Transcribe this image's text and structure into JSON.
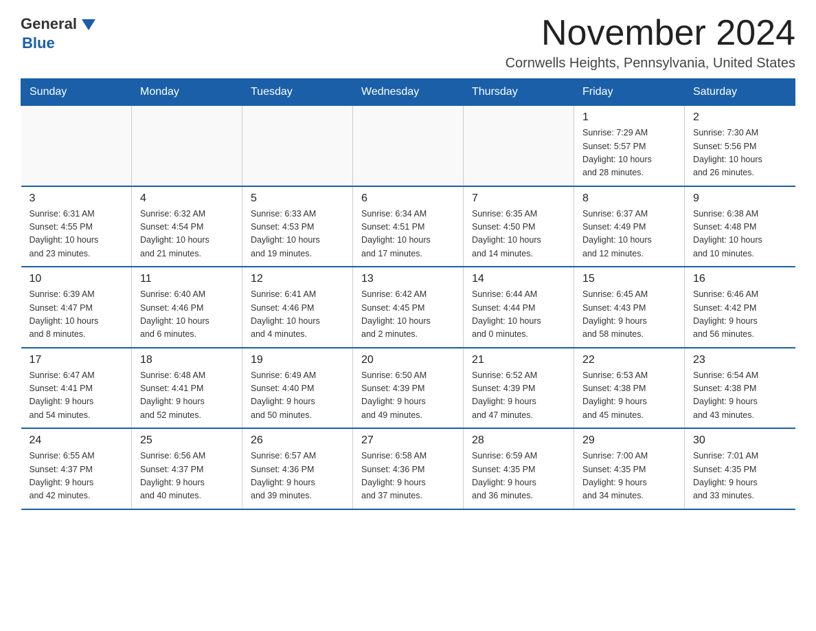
{
  "header": {
    "logo_general": "General",
    "logo_blue": "Blue",
    "month_title": "November 2024",
    "location": "Cornwells Heights, Pennsylvania, United States"
  },
  "days_of_week": [
    "Sunday",
    "Monday",
    "Tuesday",
    "Wednesday",
    "Thursday",
    "Friday",
    "Saturday"
  ],
  "weeks": [
    [
      {
        "day": "",
        "info": ""
      },
      {
        "day": "",
        "info": ""
      },
      {
        "day": "",
        "info": ""
      },
      {
        "day": "",
        "info": ""
      },
      {
        "day": "",
        "info": ""
      },
      {
        "day": "1",
        "info": "Sunrise: 7:29 AM\nSunset: 5:57 PM\nDaylight: 10 hours\nand 28 minutes."
      },
      {
        "day": "2",
        "info": "Sunrise: 7:30 AM\nSunset: 5:56 PM\nDaylight: 10 hours\nand 26 minutes."
      }
    ],
    [
      {
        "day": "3",
        "info": "Sunrise: 6:31 AM\nSunset: 4:55 PM\nDaylight: 10 hours\nand 23 minutes."
      },
      {
        "day": "4",
        "info": "Sunrise: 6:32 AM\nSunset: 4:54 PM\nDaylight: 10 hours\nand 21 minutes."
      },
      {
        "day": "5",
        "info": "Sunrise: 6:33 AM\nSunset: 4:53 PM\nDaylight: 10 hours\nand 19 minutes."
      },
      {
        "day": "6",
        "info": "Sunrise: 6:34 AM\nSunset: 4:51 PM\nDaylight: 10 hours\nand 17 minutes."
      },
      {
        "day": "7",
        "info": "Sunrise: 6:35 AM\nSunset: 4:50 PM\nDaylight: 10 hours\nand 14 minutes."
      },
      {
        "day": "8",
        "info": "Sunrise: 6:37 AM\nSunset: 4:49 PM\nDaylight: 10 hours\nand 12 minutes."
      },
      {
        "day": "9",
        "info": "Sunrise: 6:38 AM\nSunset: 4:48 PM\nDaylight: 10 hours\nand 10 minutes."
      }
    ],
    [
      {
        "day": "10",
        "info": "Sunrise: 6:39 AM\nSunset: 4:47 PM\nDaylight: 10 hours\nand 8 minutes."
      },
      {
        "day": "11",
        "info": "Sunrise: 6:40 AM\nSunset: 4:46 PM\nDaylight: 10 hours\nand 6 minutes."
      },
      {
        "day": "12",
        "info": "Sunrise: 6:41 AM\nSunset: 4:46 PM\nDaylight: 10 hours\nand 4 minutes."
      },
      {
        "day": "13",
        "info": "Sunrise: 6:42 AM\nSunset: 4:45 PM\nDaylight: 10 hours\nand 2 minutes."
      },
      {
        "day": "14",
        "info": "Sunrise: 6:44 AM\nSunset: 4:44 PM\nDaylight: 10 hours\nand 0 minutes."
      },
      {
        "day": "15",
        "info": "Sunrise: 6:45 AM\nSunset: 4:43 PM\nDaylight: 9 hours\nand 58 minutes."
      },
      {
        "day": "16",
        "info": "Sunrise: 6:46 AM\nSunset: 4:42 PM\nDaylight: 9 hours\nand 56 minutes."
      }
    ],
    [
      {
        "day": "17",
        "info": "Sunrise: 6:47 AM\nSunset: 4:41 PM\nDaylight: 9 hours\nand 54 minutes."
      },
      {
        "day": "18",
        "info": "Sunrise: 6:48 AM\nSunset: 4:41 PM\nDaylight: 9 hours\nand 52 minutes."
      },
      {
        "day": "19",
        "info": "Sunrise: 6:49 AM\nSunset: 4:40 PM\nDaylight: 9 hours\nand 50 minutes."
      },
      {
        "day": "20",
        "info": "Sunrise: 6:50 AM\nSunset: 4:39 PM\nDaylight: 9 hours\nand 49 minutes."
      },
      {
        "day": "21",
        "info": "Sunrise: 6:52 AM\nSunset: 4:39 PM\nDaylight: 9 hours\nand 47 minutes."
      },
      {
        "day": "22",
        "info": "Sunrise: 6:53 AM\nSunset: 4:38 PM\nDaylight: 9 hours\nand 45 minutes."
      },
      {
        "day": "23",
        "info": "Sunrise: 6:54 AM\nSunset: 4:38 PM\nDaylight: 9 hours\nand 43 minutes."
      }
    ],
    [
      {
        "day": "24",
        "info": "Sunrise: 6:55 AM\nSunset: 4:37 PM\nDaylight: 9 hours\nand 42 minutes."
      },
      {
        "day": "25",
        "info": "Sunrise: 6:56 AM\nSunset: 4:37 PM\nDaylight: 9 hours\nand 40 minutes."
      },
      {
        "day": "26",
        "info": "Sunrise: 6:57 AM\nSunset: 4:36 PM\nDaylight: 9 hours\nand 39 minutes."
      },
      {
        "day": "27",
        "info": "Sunrise: 6:58 AM\nSunset: 4:36 PM\nDaylight: 9 hours\nand 37 minutes."
      },
      {
        "day": "28",
        "info": "Sunrise: 6:59 AM\nSunset: 4:35 PM\nDaylight: 9 hours\nand 36 minutes."
      },
      {
        "day": "29",
        "info": "Sunrise: 7:00 AM\nSunset: 4:35 PM\nDaylight: 9 hours\nand 34 minutes."
      },
      {
        "day": "30",
        "info": "Sunrise: 7:01 AM\nSunset: 4:35 PM\nDaylight: 9 hours\nand 33 minutes."
      }
    ]
  ]
}
